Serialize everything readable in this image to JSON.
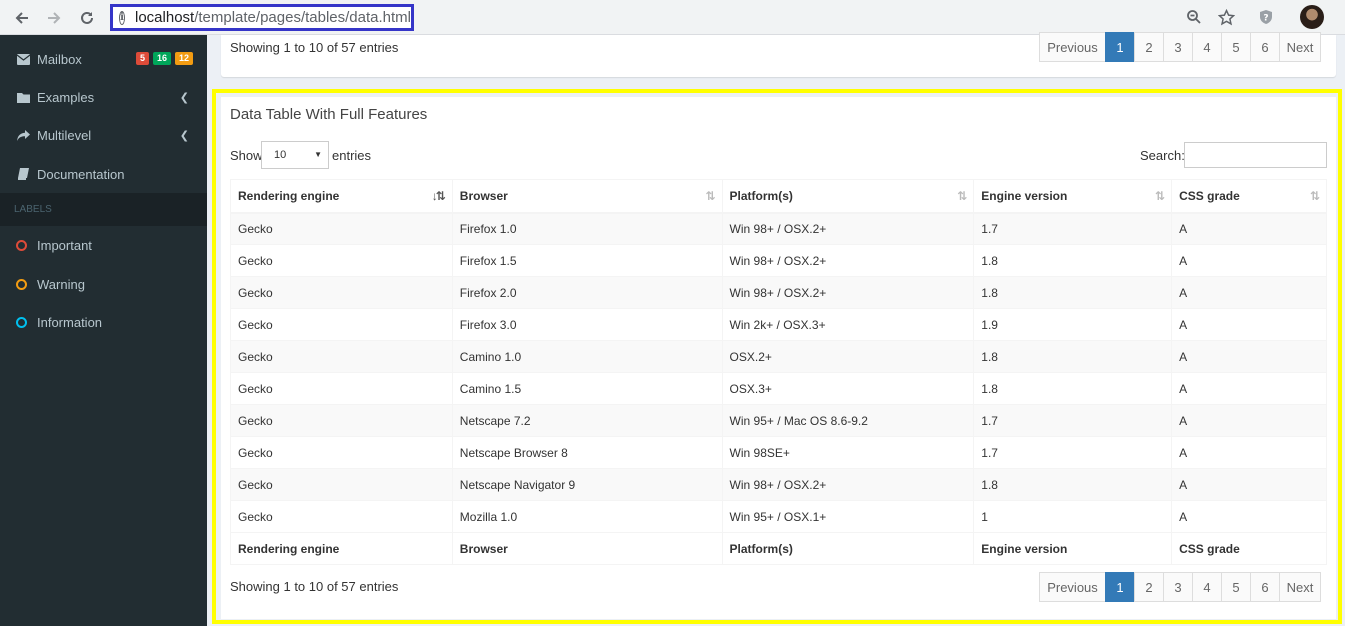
{
  "browser": {
    "url_host": "localhost",
    "url_path": "/template/pages/tables/data.html"
  },
  "sidebar": {
    "items": [
      {
        "label": "Mailbox",
        "icon": "envelope-icon"
      },
      {
        "label": "Examples",
        "icon": "folder-icon"
      },
      {
        "label": "Multilevel",
        "icon": "share-icon"
      },
      {
        "label": "Documentation",
        "icon": "book-icon"
      }
    ],
    "mailbox_badges": [
      {
        "text": "5",
        "color": "#dd4b39"
      },
      {
        "text": "16",
        "color": "#00a65a"
      },
      {
        "text": "12",
        "color": "#f39c12"
      }
    ],
    "labels_header": "LABELS",
    "labels": [
      {
        "label": "Important",
        "color": "#dd4b39"
      },
      {
        "label": "Warning",
        "color": "#f39c12"
      },
      {
        "label": "Information",
        "color": "#00c0ef"
      }
    ]
  },
  "top_box": {
    "showing": "Showing 1 to 10 of 57 entries"
  },
  "pagination": {
    "previous": "Previous",
    "pages": [
      "1",
      "2",
      "3",
      "4",
      "5",
      "6"
    ],
    "active_page": "1",
    "next": "Next"
  },
  "main_box": {
    "title": "Data Table With Full Features",
    "show_label": "Show",
    "show_value": "10",
    "entries_label": "entries",
    "search_label": "Search:",
    "search_value": "",
    "showing": "Showing 1 to 10 of 57 entries"
  },
  "table": {
    "columns": [
      "Rendering engine",
      "Browser",
      "Platform(s)",
      "Engine version",
      "CSS grade"
    ],
    "rows": [
      [
        "Gecko",
        "Firefox 1.0",
        "Win 98+ / OSX.2+",
        "1.7",
        "A"
      ],
      [
        "Gecko",
        "Firefox 1.5",
        "Win 98+ / OSX.2+",
        "1.8",
        "A"
      ],
      [
        "Gecko",
        "Firefox 2.0",
        "Win 98+ / OSX.2+",
        "1.8",
        "A"
      ],
      [
        "Gecko",
        "Firefox 3.0",
        "Win 2k+ / OSX.3+",
        "1.9",
        "A"
      ],
      [
        "Gecko",
        "Camino 1.0",
        "OSX.2+",
        "1.8",
        "A"
      ],
      [
        "Gecko",
        "Camino 1.5",
        "OSX.3+",
        "1.8",
        "A"
      ],
      [
        "Gecko",
        "Netscape 7.2",
        "Win 95+ / Mac OS 8.6-9.2",
        "1.7",
        "A"
      ],
      [
        "Gecko",
        "Netscape Browser 8",
        "Win 98SE+",
        "1.7",
        "A"
      ],
      [
        "Gecko",
        "Netscape Navigator 9",
        "Win 98+ / OSX.2+",
        "1.8",
        "A"
      ],
      [
        "Gecko",
        "Mozilla 1.0",
        "Win 95+ / OSX.1+",
        "1",
        "A"
      ]
    ]
  }
}
